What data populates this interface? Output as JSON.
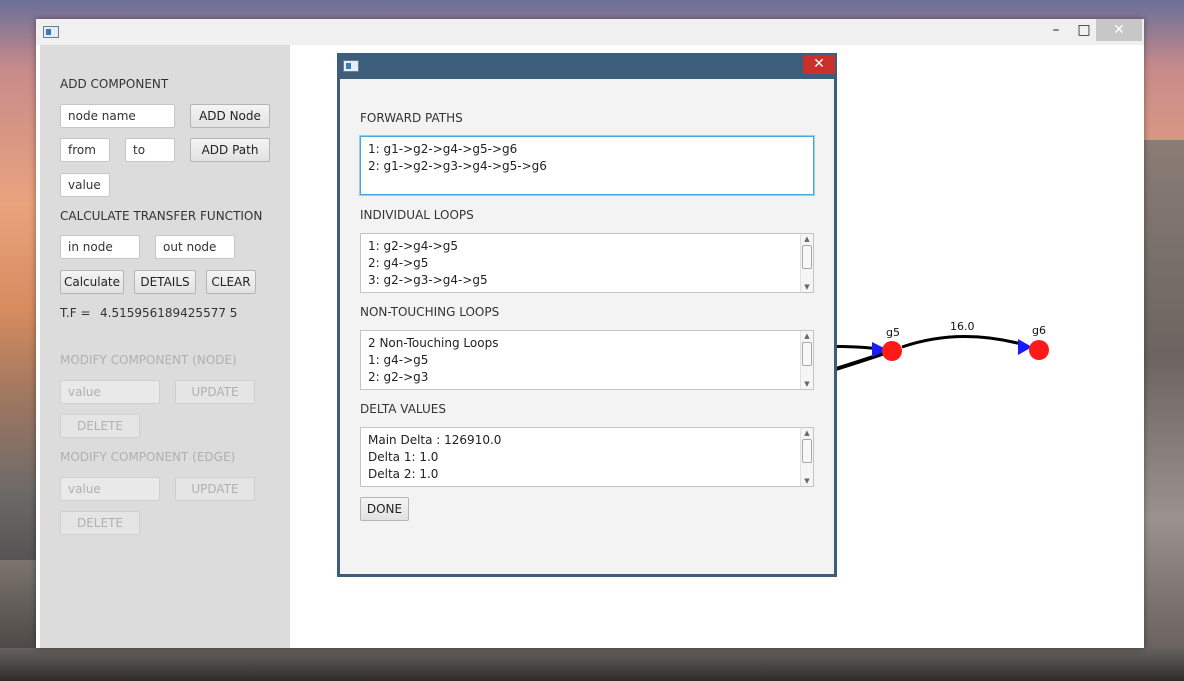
{
  "sidebar": {
    "add_component_label": "ADD COMPONENT",
    "node_name_value": "node name",
    "add_node_button": "ADD Node",
    "from_value": "from",
    "to_value": "to",
    "add_path_button": "ADD Path",
    "value_value": "value",
    "calculate_label": "CALCULATE TRANSFER FUNCTION",
    "in_node_value": "in node",
    "out_node_value": "out node",
    "calculate_button": "Calculate",
    "details_button": "DETAILS",
    "clear_button": "CLEAR",
    "tf_label": "T.F =",
    "tf_value": "4.515956189425577 5",
    "modify_node_label": "MODIFY COMPONENT (NODE)",
    "node_value_placeholder": "value",
    "node_update_button": "UPDATE",
    "node_delete_button": "DELETE",
    "modify_edge_label": "MODIFY COMPONENT (EDGE)",
    "edge_value_placeholder": "value",
    "edge_update_button": "UPDATE",
    "edge_delete_button": "DELETE"
  },
  "graph": {
    "nodes": [
      {
        "label": "g5"
      },
      {
        "label": "g6"
      }
    ],
    "edge_label": "16.0",
    "node_color": "#ff1a1a",
    "arrow_color": "#1a1aff"
  },
  "dialog": {
    "forward_paths_label": "FORWARD PATHS",
    "forward_paths": [
      "1: g1->g2->g4->g5->g6",
      "2: g1->g2->g3->g4->g5->g6"
    ],
    "individual_loops_label": "INDIVIDUAL LOOPS",
    "individual_loops": [
      "1: g2->g4->g5",
      "2: g4->g5",
      "3: g2->g3->g4->g5"
    ],
    "non_touching_label": "NON-TOUCHING LOOPS",
    "non_touching_loops": [
      "2 Non-Touching Loops",
      "1: g4->g5",
      "2: g2->g3"
    ],
    "delta_label": "DELTA VALUES",
    "delta_values": [
      "Main Delta : 126910.0",
      "Delta 1: 1.0",
      "Delta 2: 1.0"
    ],
    "done_button": "DONE"
  },
  "window": {
    "minimize_glyph": "–",
    "maximize_glyph": "□",
    "close_glyph": "✕"
  }
}
